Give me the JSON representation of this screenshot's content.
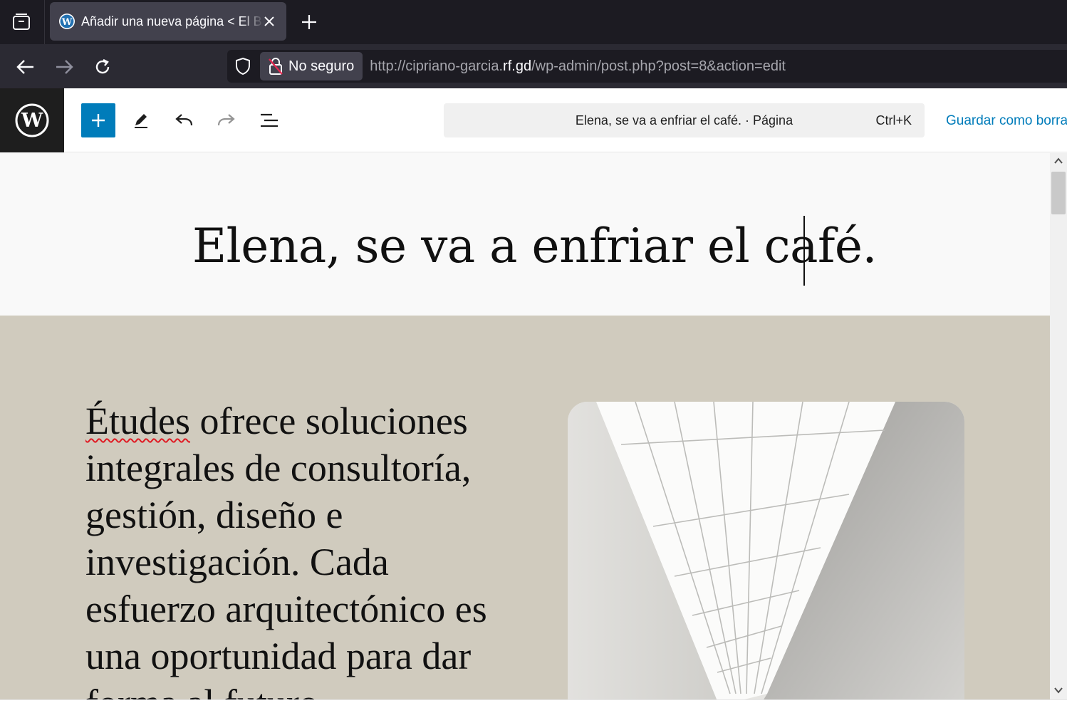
{
  "browser": {
    "tab": {
      "title": "Añadir una nueva página < El Blog de Cipriano",
      "favicon": "wordpress-icon"
    },
    "nav": {
      "back": "back-arrow-icon",
      "forward": "forward-arrow-icon",
      "reload": "reload-icon"
    },
    "urlbar": {
      "security_label": "No seguro",
      "url_prefix": "http://cipriano-garcia.",
      "url_host": "rf.gd",
      "url_path": "/wp-admin/post.php?post=8&action=edit"
    }
  },
  "editor_toolbar": {
    "logo": "wordpress-logo",
    "add_block": "plus-icon",
    "tools": [
      "pencil-icon",
      "undo-icon",
      "redo-icon",
      "document-overview-icon"
    ],
    "command_title": "Elena, se va a enfriar el café. · Página",
    "command_shortcut": "Ctrl+K",
    "save_draft_label": "Guardar como borrador"
  },
  "content": {
    "post_title": "Elena, se va a enfriar el café.",
    "paragraph_first_word": "Études",
    "paragraph_rest": " ofrece soluciones integrales de consultoría, gestión, diseño e investigación. Cada esfuerzo arquitectónico es una oportunidad para dar forma al futuro.",
    "image_alt": "architecture-photo"
  },
  "colors": {
    "wp_blue": "#007cba",
    "section_bg": "#d0cbbe",
    "browser_dark": "#1c1b22"
  }
}
